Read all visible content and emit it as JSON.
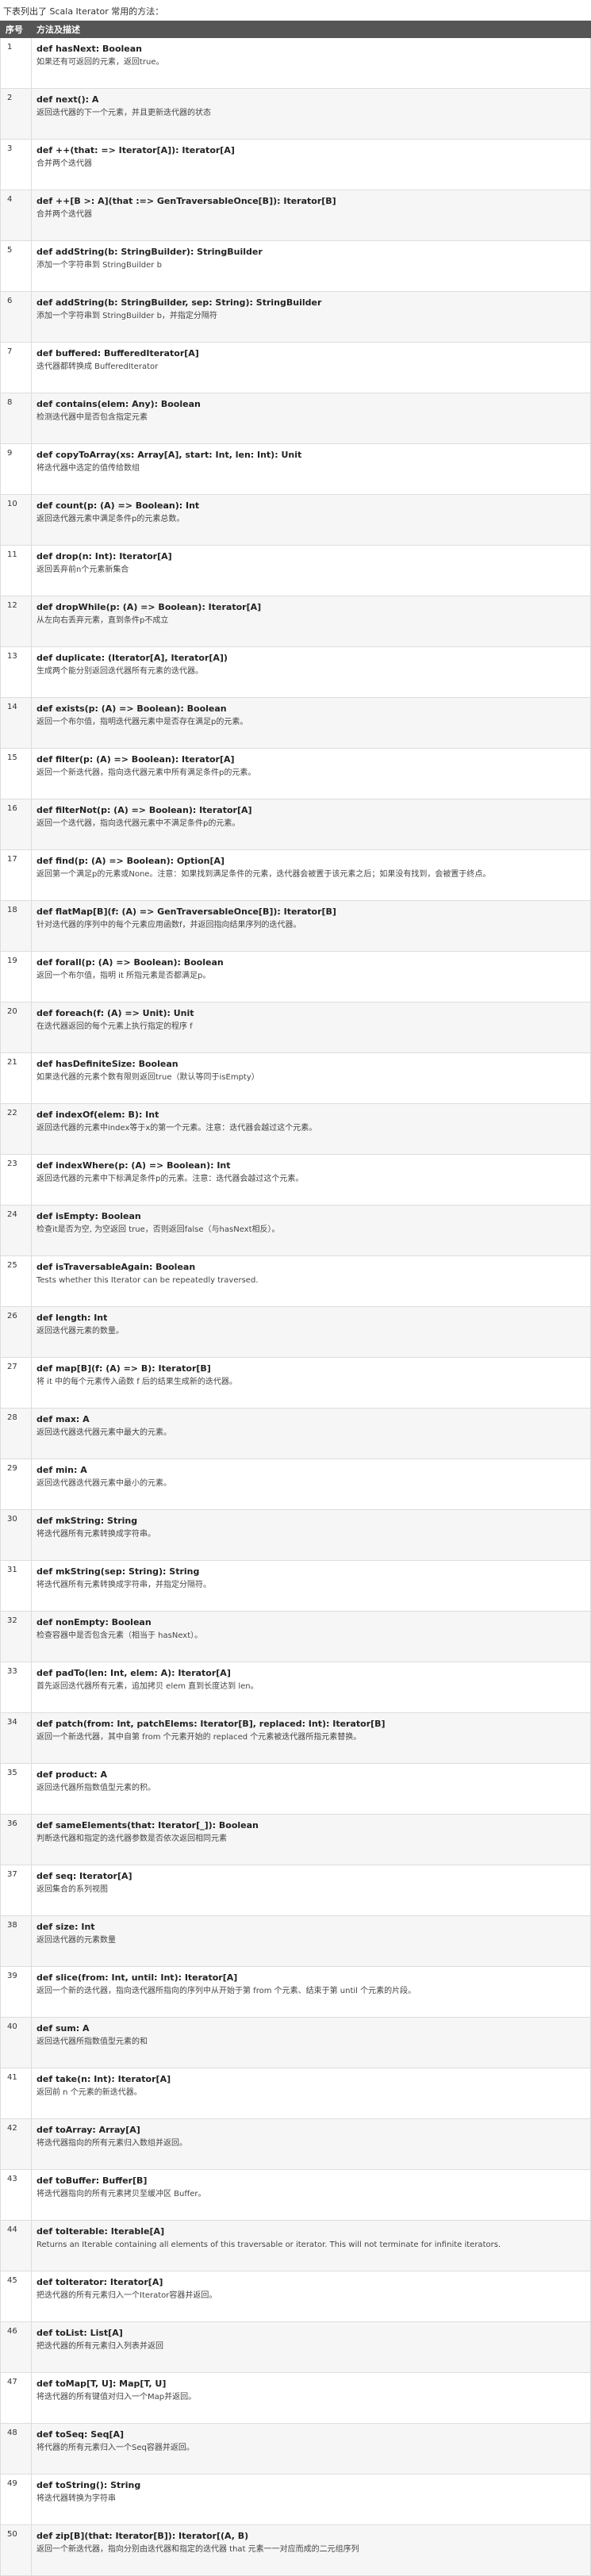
{
  "intro": "下表列出了 Scala Iterator 常用的方法：",
  "table": {
    "headers": [
      "序号",
      "方法及描述"
    ],
    "rows": [
      {
        "num": "1",
        "sig": "def hasNext: Boolean",
        "desc": "如果还有可返回的元素，返回true。"
      },
      {
        "num": "2",
        "sig": "def next(): A",
        "desc": "返回迭代器的下一个元素，并且更新迭代器的状态"
      },
      {
        "num": "3",
        "sig": "def ++(that: => Iterator[A]): Iterator[A]",
        "desc": "合并两个迭代器"
      },
      {
        "num": "4",
        "sig": "def ++[B >: A](that :=> GenTraversableOnce[B]): Iterator[B]",
        "desc": "合并两个迭代器"
      },
      {
        "num": "5",
        "sig": "def addString(b: StringBuilder): StringBuilder",
        "desc": "添加一个字符串到 StringBuilder b"
      },
      {
        "num": "6",
        "sig": "def addString(b: StringBuilder, sep: String): StringBuilder",
        "desc": "添加一个字符串到 StringBuilder b，并指定分隔符"
      },
      {
        "num": "7",
        "sig": "def buffered: BufferedIterator[A]",
        "desc": "迭代器都转换成 BufferedIterator"
      },
      {
        "num": "8",
        "sig": "def contains(elem: Any): Boolean",
        "desc": "检测迭代器中是否包含指定元素"
      },
      {
        "num": "9",
        "sig": "def copyToArray(xs: Array[A], start: Int, len: Int): Unit",
        "desc": "将迭代器中选定的值传给数组"
      },
      {
        "num": "10",
        "sig": "def count(p: (A) => Boolean): Int",
        "desc": "返回迭代器元素中满足条件p的元素总数。"
      },
      {
        "num": "11",
        "sig": "def drop(n: Int): Iterator[A]",
        "desc": "返回丢弃前n个元素新集合"
      },
      {
        "num": "12",
        "sig": "def dropWhile(p: (A) => Boolean): Iterator[A]",
        "desc": "从左向右丢弃元素，直到条件p不成立"
      },
      {
        "num": "13",
        "sig": "def duplicate: (Iterator[A], Iterator[A])",
        "desc": "生成两个能分别返回迭代器所有元素的迭代器。"
      },
      {
        "num": "14",
        "sig": "def exists(p: (A) => Boolean): Boolean",
        "desc": "返回一个布尔值，指明迭代器元素中是否存在满足p的元素。"
      },
      {
        "num": "15",
        "sig": "def filter(p: (A) => Boolean): Iterator[A]",
        "desc": "返回一个新迭代器，指向迭代器元素中所有满足条件p的元素。"
      },
      {
        "num": "16",
        "sig": "def filterNot(p: (A) => Boolean): Iterator[A]",
        "desc": "返回一个迭代器，指向迭代器元素中不满足条件p的元素。"
      },
      {
        "num": "17",
        "sig": "def find(p: (A) => Boolean): Option[A]",
        "desc": "返回第一个满足p的元素或None。注意：如果找到满足条件的元素，迭代器会被置于该元素之后；如果没有找到，会被置于终点。"
      },
      {
        "num": "18",
        "sig": "def flatMap[B](f: (A) => GenTraversableOnce[B]): Iterator[B]",
        "desc": "针对迭代器的序列中的每个元素应用函数f，并返回指向结果序列的迭代器。"
      },
      {
        "num": "19",
        "sig": "def forall(p: (A) => Boolean): Boolean",
        "desc": "返回一个布尔值，指明 it 所指元素是否都满足p。"
      },
      {
        "num": "20",
        "sig": "def foreach(f: (A) => Unit): Unit",
        "desc": "在迭代器返回的每个元素上执行指定的程序 f"
      },
      {
        "num": "21",
        "sig": "def hasDefiniteSize: Boolean",
        "desc": "如果迭代器的元素个数有限则返回true（默认等同于isEmpty）"
      },
      {
        "num": "22",
        "sig": "def indexOf(elem: B): Int",
        "desc": "返回迭代器的元素中index等于x的第一个元素。注意：迭代器会越过这个元素。"
      },
      {
        "num": "23",
        "sig": "def indexWhere(p: (A) => Boolean): Int",
        "desc": "返回迭代器的元素中下标满足条件p的元素。注意：迭代器会越过这个元素。"
      },
      {
        "num": "24",
        "sig": "def isEmpty: Boolean",
        "desc": "检查it是否为空, 为空返回 true，否则返回false（与hasNext相反）。"
      },
      {
        "num": "25",
        "sig": "def isTraversableAgain: Boolean",
        "desc": "Tests whether this Iterator can be repeatedly traversed."
      },
      {
        "num": "26",
        "sig": "def length: Int",
        "desc": "返回迭代器元素的数量。"
      },
      {
        "num": "27",
        "sig": "def map[B](f: (A) => B): Iterator[B]",
        "desc": "将 it 中的每个元素传入函数 f 后的结果生成新的迭代器。"
      },
      {
        "num": "28",
        "sig": "def max: A",
        "desc": "返回迭代器迭代器元素中最大的元素。"
      },
      {
        "num": "29",
        "sig": "def min: A",
        "desc": "返回迭代器迭代器元素中最小的元素。"
      },
      {
        "num": "30",
        "sig": "def mkString: String",
        "desc": "将迭代器所有元素转换成字符串。"
      },
      {
        "num": "31",
        "sig": "def mkString(sep: String): String",
        "desc": "将迭代器所有元素转换成字符串，并指定分隔符。"
      },
      {
        "num": "32",
        "sig": "def nonEmpty: Boolean",
        "desc": "检查容器中是否包含元素（相当于 hasNext）。"
      },
      {
        "num": "33",
        "sig": "def padTo(len: Int, elem: A): Iterator[A]",
        "desc": "首先返回迭代器所有元素，追加拷贝 elem 直到长度达到 len。"
      },
      {
        "num": "34",
        "sig": "def patch(from: Int, patchElems: Iterator[B], replaced: Int): Iterator[B]",
        "desc": "返回一个新迭代器，其中自第 from 个元素开始的 replaced 个元素被迭代器所指元素替换。"
      },
      {
        "num": "35",
        "sig": "def product: A",
        "desc": "返回迭代器所指数值型元素的积。"
      },
      {
        "num": "36",
        "sig": "def sameElements(that: Iterator[_]): Boolean",
        "desc": "判断迭代器和指定的迭代器参数是否依次返回相同元素"
      },
      {
        "num": "37",
        "sig": "def seq: Iterator[A]",
        "desc": "返回集合的系列视图"
      },
      {
        "num": "38",
        "sig": "def size: Int",
        "desc": "返回迭代器的元素数量"
      },
      {
        "num": "39",
        "sig": "def slice(from: Int, until: Int): Iterator[A]",
        "desc": "返回一个新的迭代器，指向迭代器所指向的序列中从开始于第 from 个元素、结束于第 until 个元素的片段。"
      },
      {
        "num": "40",
        "sig": "def sum: A",
        "desc": "返回迭代器所指数值型元素的和"
      },
      {
        "num": "41",
        "sig": "def take(n: Int): Iterator[A]",
        "desc": "返回前 n 个元素的新迭代器。"
      },
      {
        "num": "42",
        "sig": "def toArray: Array[A]",
        "desc": "将迭代器指向的所有元素归入数组并返回。"
      },
      {
        "num": "43",
        "sig": "def toBuffer: Buffer[B]",
        "desc": "将迭代器指向的所有元素拷贝至缓冲区 Buffer。"
      },
      {
        "num": "44",
        "sig": "def toIterable: Iterable[A]",
        "desc": "Returns an Iterable containing all elements of this traversable or iterator. This will not terminate for infinite iterators."
      },
      {
        "num": "45",
        "sig": "def toIterator: Iterator[A]",
        "desc": "把迭代器的所有元素归入一个Iterator容器并返回。"
      },
      {
        "num": "46",
        "sig": "def toList: List[A]",
        "desc": "把迭代器的所有元素归入列表并返回"
      },
      {
        "num": "47",
        "sig": "def toMap[T, U]: Map[T, U]",
        "desc": "将迭代器的所有键值对归入一个Map并返回。"
      },
      {
        "num": "48",
        "sig": "def toSeq: Seq[A]",
        "desc": "将代器的所有元素归入一个Seq容器并返回。"
      },
      {
        "num": "49",
        "sig": "def toString(): String",
        "desc": "将迭代器转换为字符串"
      },
      {
        "num": "50",
        "sig": "def zip[B](that: Iterator[B]): Iterator[(A, B)",
        "desc": "返回一个新迭代器，指向分别由迭代器和指定的迭代器 that 元素一一对应而成的二元组序列"
      }
    ]
  }
}
